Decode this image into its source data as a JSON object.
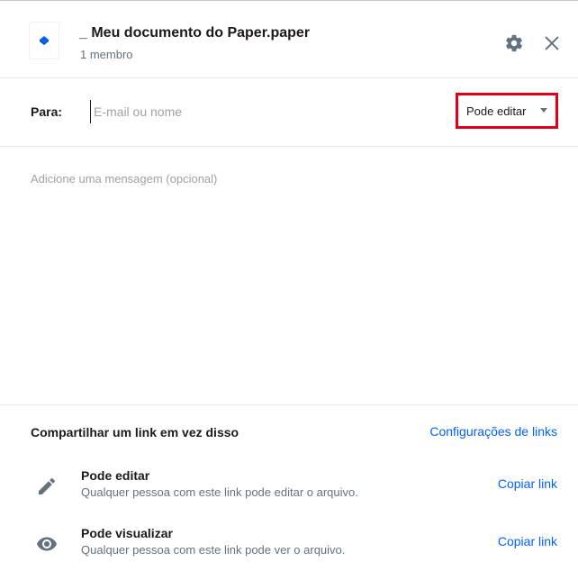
{
  "header": {
    "title": "_ Meu documento do Paper.paper",
    "subtitle": "1 membro",
    "doc_icon": "paper-doc-icon",
    "settings_icon": "gear-icon",
    "close_icon": "close-icon"
  },
  "recipient": {
    "label": "Para:",
    "placeholder": "E-mail ou nome",
    "value": "",
    "permission": {
      "selected": "Pode editar",
      "icon": "chevron-down-icon",
      "highlight_color": "#e0001a"
    }
  },
  "message": {
    "placeholder": "Adicione uma mensagem (opcional)",
    "value": ""
  },
  "share_link": {
    "heading": "Compartilhar um link em vez disso",
    "settings_label": "Configurações de links",
    "options": [
      {
        "title": "Pode editar",
        "description": "Qualquer pessoa com este link pode editar o arquivo.",
        "icon": "pencil-icon",
        "action": "Copiar link"
      },
      {
        "title": "Pode visualizar",
        "description": "Qualquer pessoa com este link pode ver o arquivo.",
        "icon": "eye-icon",
        "action": "Copiar link"
      }
    ]
  },
  "colors": {
    "link": "#0061fe",
    "text_primary": "#1e1919",
    "text_secondary": "#637282",
    "brand": "#0061fe"
  }
}
